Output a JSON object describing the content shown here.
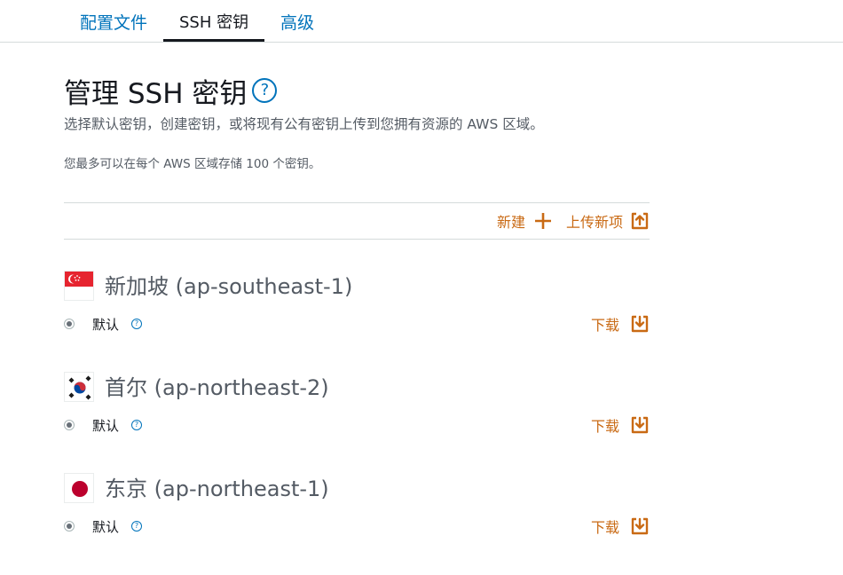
{
  "tabs": [
    {
      "label": "配置文件",
      "active": false
    },
    {
      "label": "SSH 密钥",
      "active": true
    },
    {
      "label": "高级",
      "active": false
    }
  ],
  "page": {
    "title": "管理 SSH 密钥",
    "help_glyph": "?",
    "description": "选择默认密钥，创建密钥，或将现有公有密钥上传到您拥有资源的 AWS 区域。",
    "limit_note": "您最多可以在每个 AWS 区域存储 100 个密钥。"
  },
  "actions": {
    "new_label": "新建",
    "upload_label": "上传新项"
  },
  "regions": [
    {
      "name": "新加坡",
      "code": "(ap-southeast-1)",
      "flag": "singapore-flag",
      "default_label": "默认",
      "download_label": "下载",
      "help_glyph": "?"
    },
    {
      "name": "首尔",
      "code": "(ap-northeast-2)",
      "flag": "south-korea-flag",
      "default_label": "默认",
      "download_label": "下载",
      "help_glyph": "?"
    },
    {
      "name": "东京",
      "code": "(ap-northeast-1)",
      "flag": "japan-flag",
      "default_label": "默认",
      "download_label": "下载",
      "help_glyph": "?"
    }
  ],
  "colors": {
    "link_blue": "#0073bb",
    "action_orange": "#c96a14",
    "text_dark": "#16191f",
    "text_gray": "#545b64"
  }
}
